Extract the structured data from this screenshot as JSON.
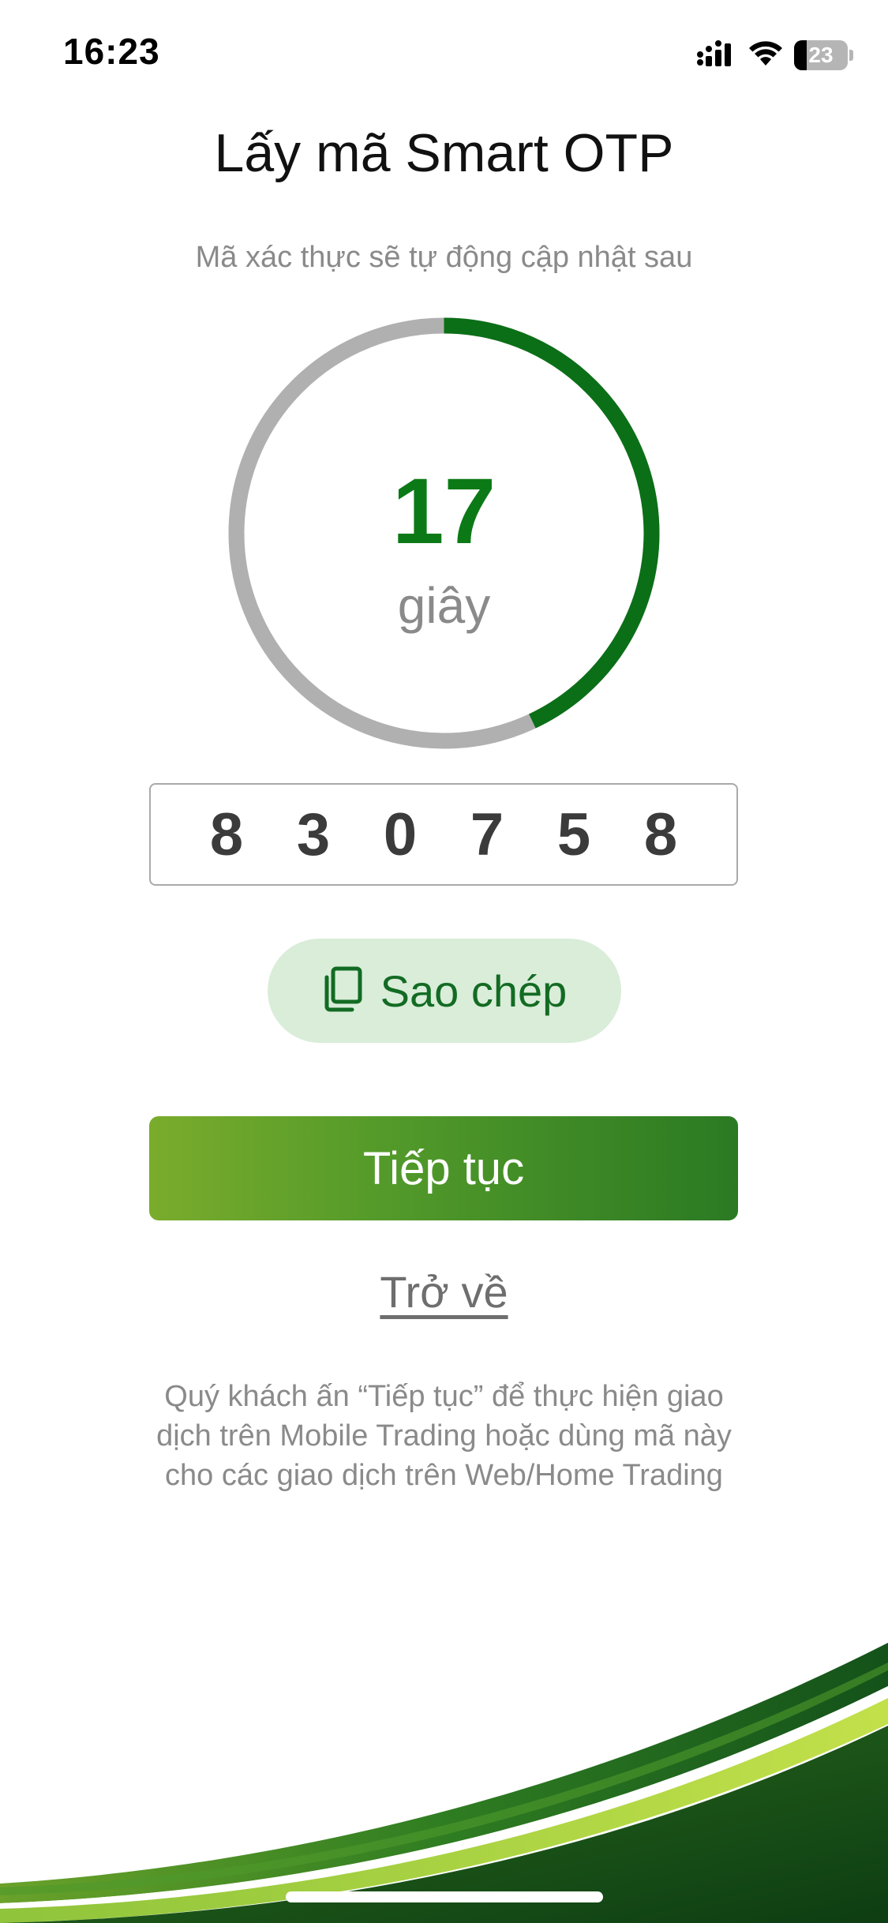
{
  "status_bar": {
    "time": "16:23",
    "battery_level": "23",
    "icons": [
      "signal-icon",
      "wifi-icon",
      "battery-icon"
    ]
  },
  "page": {
    "title": "Lấy mã Smart OTP",
    "subtitle": "Mã xác thực sẽ tự động cập nhật sau"
  },
  "countdown": {
    "seconds": "17",
    "unit": "giây",
    "progress_fraction": 0.43,
    "colors": {
      "progress": "#0b6f17",
      "track": "#b0b0b0"
    }
  },
  "otp": {
    "digits": [
      "8",
      "3",
      "0",
      "7",
      "5",
      "8"
    ]
  },
  "actions": {
    "copy_label": "Sao chép",
    "continue_label": "Tiếp tục",
    "back_label": "Trở về"
  },
  "instruction": {
    "lines": [
      "Quý khách ấn “Tiếp tục” để thực hiện giao",
      "dịch trên Mobile Trading hoặc dùng mã này",
      "cho các giao dịch trên Web/Home Trading"
    ]
  },
  "theme": {
    "accent": "#136b23",
    "button_gradient_start": "#7aac2c",
    "button_gradient_end": "#2b7a23",
    "copy_bg": "#d9edd9"
  }
}
